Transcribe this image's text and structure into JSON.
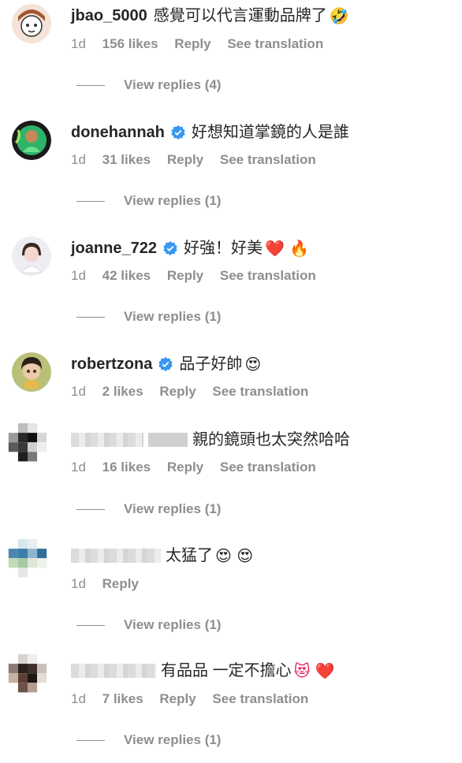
{
  "comments": [
    {
      "username": "jbao_5000",
      "verified": false,
      "text": "感覺可以代言運動品牌了",
      "emoji": "🤣",
      "time": "1d",
      "likes": "156 likes",
      "reply": "Reply",
      "translate": "See translation",
      "view_replies": "View replies (4)"
    },
    {
      "username": "donehannah",
      "verified": true,
      "text": "好想知道掌鏡的人是誰",
      "emoji": "",
      "time": "1d",
      "likes": "31 likes",
      "reply": "Reply",
      "translate": "See translation",
      "view_replies": "View replies (1)"
    },
    {
      "username": "joanne_722",
      "verified": true,
      "text": "好強！好美",
      "emoji": "❤️ 🔥",
      "time": "1d",
      "likes": "42 likes",
      "reply": "Reply",
      "translate": "See translation",
      "view_replies": "View replies (1)"
    },
    {
      "username": "robertzona",
      "verified": true,
      "text": "品子好帥",
      "emoji": "😍",
      "time": "1d",
      "likes": "2 likes",
      "reply": "Reply",
      "translate": "See translation",
      "view_replies": ""
    },
    {
      "username": "",
      "verified": false,
      "text": "親的鏡頭也太突然哈哈",
      "emoji": "",
      "time": "1d",
      "likes": "16 likes",
      "reply": "Reply",
      "translate": "See translation",
      "view_replies": "View replies (1)"
    },
    {
      "username": "",
      "verified": false,
      "text": "太猛了",
      "emoji": "😍 😍",
      "time": "1d",
      "likes": "",
      "reply": "Reply",
      "translate": "",
      "view_replies": "View replies (1)"
    },
    {
      "username": "",
      "verified": false,
      "text": "有品品 一定不擔心",
      "emoji": "😻 ❤️",
      "time": "1d",
      "likes": "7 likes",
      "reply": "Reply",
      "translate": "See translation",
      "view_replies": "View replies (1)"
    }
  ],
  "colors": {
    "text": "#262626",
    "secondary": "#8e8e8e",
    "verified": "#3897f0"
  }
}
